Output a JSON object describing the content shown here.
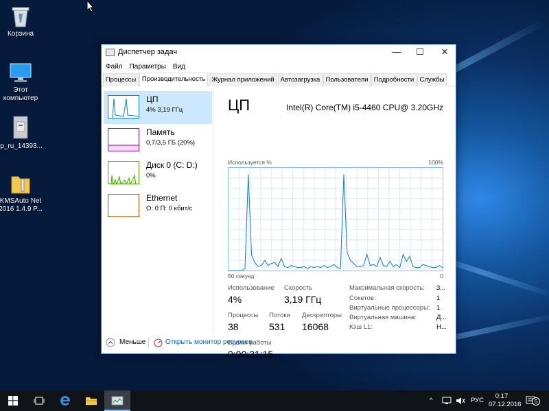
{
  "desktop": {
    "icons": [
      {
        "label": "Корзина"
      },
      {
        "label": "Этот компьютер"
      },
      {
        "label": "lp_ru_14393..."
      },
      {
        "label": "KMSAuto Net 2016 1.4.9 P..."
      }
    ]
  },
  "window": {
    "title": "Диспетчер задач",
    "menu": [
      "Файл",
      "Параметры",
      "Вид"
    ],
    "tabs": [
      "Процессы",
      "Производительность",
      "Журнал приложений",
      "Автозагрузка",
      "Пользователи",
      "Подробности",
      "Службы"
    ],
    "active_tab": "Производительность",
    "side": [
      {
        "name": "ЦП",
        "sub": "4% 3,19 ГГц",
        "color": "#117dbb"
      },
      {
        "name": "Память",
        "sub": "0,7/3,5 ГБ (20%)",
        "color": "#8b12ae"
      },
      {
        "name": "Диск 0 (C: D:)",
        "sub": "0%",
        "color": "#4da60c"
      },
      {
        "name": "Ethernet",
        "sub": "О: 0 П: 0 кбит/с",
        "color": "#a74f01"
      }
    ],
    "main": {
      "title": "ЦП",
      "cpu_name": "Intel(R) Core(TM) i5-4460 CPU@ 3.20GHz",
      "graph_ylabel": "Используется %",
      "graph_ymax": "100%",
      "graph_xlabel": "60 секунд",
      "graph_xmin": "0",
      "graph_color": "#117dbb",
      "usage_series": [
        0,
        0,
        0,
        0,
        0,
        2,
        95,
        15,
        8,
        4,
        5,
        10,
        5,
        7,
        8,
        4,
        12,
        4,
        3,
        5,
        4,
        3,
        3,
        4,
        2,
        4,
        3,
        4,
        3,
        5,
        3,
        4,
        6,
        3,
        2,
        95,
        18,
        10,
        7,
        4,
        4,
        5,
        16,
        5,
        6,
        4,
        13,
        5,
        4,
        9,
        4,
        6,
        3,
        16,
        9,
        14,
        4,
        3,
        3,
        6,
        5,
        4,
        3,
        3,
        5,
        3
      ],
      "stats": {
        "usage_label": "Использование",
        "usage_value": "4%",
        "speed_label": "Скорость",
        "speed_value": "3,19 ГГц",
        "processes_label": "Процессы",
        "processes_value": "38",
        "threads_label": "Потоки",
        "threads_value": "531",
        "handles_label": "Дескрипторы",
        "handles_value": "16068",
        "uptime_label": "Время работы",
        "uptime_value": "0:00:31:15"
      },
      "specs": [
        {
          "label": "Максимальная скорость:",
          "value": "3..."
        },
        {
          "label": "Сокетов:",
          "value": "1"
        },
        {
          "label": "Виртуальные процессоры:",
          "value": "1"
        },
        {
          "label": "Виртуальная машина:",
          "value": "Д..."
        },
        {
          "label": "Кэш L1:",
          "value": "Н..."
        }
      ]
    },
    "bottom": {
      "less_label": "Меньше",
      "monitor_link": "Открыть монитор ресурсов"
    }
  },
  "taskbar": {
    "lang": "РУС",
    "time": "0:17",
    "date": "07.12.2016",
    "notifications": "5"
  }
}
